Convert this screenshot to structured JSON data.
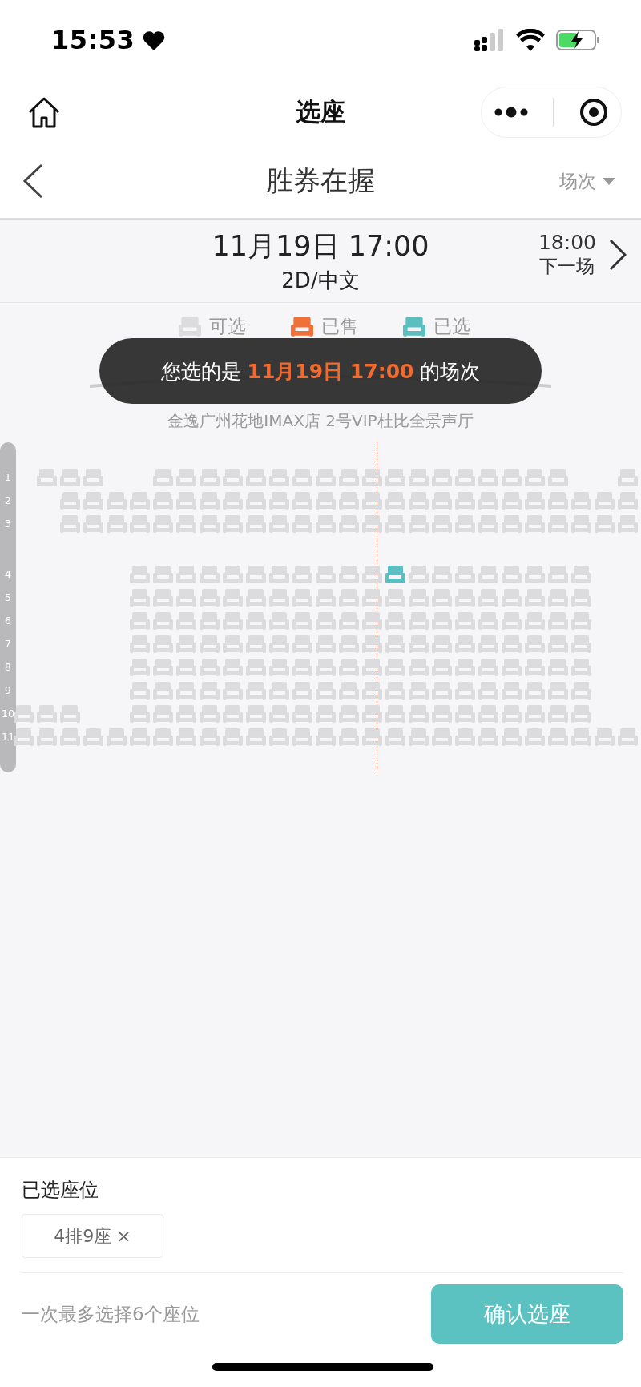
{
  "status_bar": {
    "time": "15:53"
  },
  "nav": {
    "title": "选座"
  },
  "movie": {
    "title": "胜券在握",
    "session_menu": "场次"
  },
  "session": {
    "date_time": "11月19日 17:00",
    "format": "2D/中文",
    "next_time": "18:00",
    "next_label": "下一场"
  },
  "legend": [
    {
      "kind": "available",
      "label": "可选"
    },
    {
      "kind": "sold",
      "label": "已售"
    },
    {
      "kind": "selected",
      "label": "已选"
    }
  ],
  "toast": {
    "text": "您选的是 **11月19日 17:00** 的场次"
  },
  "screen": {
    "label": "金逸广州花地IMAX店 2号VIP杜比全景声厅"
  },
  "rows": [
    {
      "label": "1",
      "cells": [
        {
          "kind": "empty"
        },
        {
          "kind": "seat",
          "selected": false
        },
        {
          "kind": "seat",
          "selected": false
        },
        {
          "kind": "seat",
          "selected": false
        },
        {
          "kind": "empty"
        },
        {
          "kind": "empty"
        },
        {
          "kind": "seat",
          "selected": false
        },
        {
          "kind": "seat",
          "selected": false
        },
        {
          "kind": "seat",
          "selected": false
        },
        {
          "kind": "seat",
          "selected": false
        },
        {
          "kind": "seat",
          "selected": false
        },
        {
          "kind": "seat",
          "selected": false
        },
        {
          "kind": "seat",
          "selected": false
        },
        {
          "kind": "seat",
          "selected": false
        },
        {
          "kind": "seat",
          "selected": false
        },
        {
          "kind": "seat",
          "selected": false
        },
        {
          "kind": "seat",
          "selected": false
        },
        {
          "kind": "seat",
          "selected": false
        },
        {
          "kind": "seat",
          "selected": false
        },
        {
          "kind": "seat",
          "selected": false
        },
        {
          "kind": "seat",
          "selected": false
        },
        {
          "kind": "seat",
          "selected": false
        },
        {
          "kind": "seat",
          "selected": false
        },
        {
          "kind": "seat",
          "selected": false
        },
        {
          "kind": "empty"
        },
        {
          "kind": "empty"
        },
        {
          "kind": "seat",
          "selected": false
        }
      ]
    },
    {
      "label": "2",
      "cells": [
        {
          "kind": "empty"
        },
        {
          "kind": "empty"
        },
        {
          "kind": "seat",
          "selected": false
        },
        {
          "kind": "seat",
          "selected": false
        },
        {
          "kind": "seat",
          "selected": false
        },
        {
          "kind": "seat",
          "selected": false
        },
        {
          "kind": "seat",
          "selected": false
        },
        {
          "kind": "seat",
          "selected": false
        },
        {
          "kind": "seat",
          "selected": false
        },
        {
          "kind": "seat",
          "selected": false
        },
        {
          "kind": "seat",
          "selected": false
        },
        {
          "kind": "seat",
          "selected": false
        },
        {
          "kind": "seat",
          "selected": false
        },
        {
          "kind": "seat",
          "selected": false
        },
        {
          "kind": "seat",
          "selected": false
        },
        {
          "kind": "seat",
          "selected": false
        },
        {
          "kind": "seat",
          "selected": false
        },
        {
          "kind": "seat",
          "selected": false
        },
        {
          "kind": "seat",
          "selected": false
        },
        {
          "kind": "seat",
          "selected": false
        },
        {
          "kind": "seat",
          "selected": false
        },
        {
          "kind": "seat",
          "selected": false
        },
        {
          "kind": "seat",
          "selected": false
        },
        {
          "kind": "seat",
          "selected": false
        },
        {
          "kind": "seat",
          "selected": false
        },
        {
          "kind": "seat",
          "selected": false
        },
        {
          "kind": "seat",
          "selected": false
        }
      ]
    },
    {
      "label": "3",
      "cells": [
        {
          "kind": "empty"
        },
        {
          "kind": "empty"
        },
        {
          "kind": "seat",
          "selected": false
        },
        {
          "kind": "seat",
          "selected": false
        },
        {
          "kind": "seat",
          "selected": false
        },
        {
          "kind": "seat",
          "selected": false
        },
        {
          "kind": "seat",
          "selected": false
        },
        {
          "kind": "seat",
          "selected": false
        },
        {
          "kind": "seat",
          "selected": false
        },
        {
          "kind": "seat",
          "selected": false
        },
        {
          "kind": "seat",
          "selected": false
        },
        {
          "kind": "seat",
          "selected": false
        },
        {
          "kind": "seat",
          "selected": false
        },
        {
          "kind": "seat",
          "selected": false
        },
        {
          "kind": "seat",
          "selected": false
        },
        {
          "kind": "seat",
          "selected": false
        },
        {
          "kind": "seat",
          "selected": false
        },
        {
          "kind": "seat",
          "selected": false
        },
        {
          "kind": "seat",
          "selected": false
        },
        {
          "kind": "seat",
          "selected": false
        },
        {
          "kind": "seat",
          "selected": false
        },
        {
          "kind": "seat",
          "selected": false
        },
        {
          "kind": "seat",
          "selected": false
        },
        {
          "kind": "seat",
          "selected": false
        },
        {
          "kind": "seat",
          "selected": false
        },
        {
          "kind": "seat",
          "selected": false
        },
        {
          "kind": "seat",
          "selected": false
        }
      ]
    },
    {
      "kind": "aisle"
    },
    {
      "label": "4",
      "cells": [
        {
          "kind": "empty"
        },
        {
          "kind": "empty"
        },
        {
          "kind": "empty"
        },
        {
          "kind": "empty"
        },
        {
          "kind": "empty"
        },
        {
          "kind": "seat",
          "selected": false
        },
        {
          "kind": "seat",
          "selected": false
        },
        {
          "kind": "seat",
          "selected": false
        },
        {
          "kind": "seat",
          "selected": false
        },
        {
          "kind": "seat",
          "selected": false
        },
        {
          "kind": "seat",
          "selected": false
        },
        {
          "kind": "seat",
          "selected": false
        },
        {
          "kind": "seat",
          "selected": false
        },
        {
          "kind": "seat",
          "selected": false
        },
        {
          "kind": "seat",
          "selected": false
        },
        {
          "kind": "seat",
          "selected": false
        },
        {
          "kind": "seat",
          "selected": true
        },
        {
          "kind": "seat",
          "selected": false
        },
        {
          "kind": "seat",
          "selected": false
        },
        {
          "kind": "seat",
          "selected": false
        },
        {
          "kind": "seat",
          "selected": false
        },
        {
          "kind": "seat",
          "selected": false
        },
        {
          "kind": "seat",
          "selected": false
        },
        {
          "kind": "seat",
          "selected": false
        },
        {
          "kind": "seat",
          "selected": false
        },
        {
          "kind": "empty"
        },
        {
          "kind": "empty"
        }
      ]
    },
    {
      "label": "5",
      "cells": [
        {
          "kind": "empty"
        },
        {
          "kind": "empty"
        },
        {
          "kind": "empty"
        },
        {
          "kind": "empty"
        },
        {
          "kind": "empty"
        },
        {
          "kind": "seat",
          "selected": false
        },
        {
          "kind": "seat",
          "selected": false
        },
        {
          "kind": "seat",
          "selected": false
        },
        {
          "kind": "seat",
          "selected": false
        },
        {
          "kind": "seat",
          "selected": false
        },
        {
          "kind": "seat",
          "selected": false
        },
        {
          "kind": "seat",
          "selected": false
        },
        {
          "kind": "seat",
          "selected": false
        },
        {
          "kind": "seat",
          "selected": false
        },
        {
          "kind": "seat",
          "selected": false
        },
        {
          "kind": "seat",
          "selected": false
        },
        {
          "kind": "seat",
          "selected": false
        },
        {
          "kind": "seat",
          "selected": false
        },
        {
          "kind": "seat",
          "selected": false
        },
        {
          "kind": "seat",
          "selected": false
        },
        {
          "kind": "seat",
          "selected": false
        },
        {
          "kind": "seat",
          "selected": false
        },
        {
          "kind": "seat",
          "selected": false
        },
        {
          "kind": "seat",
          "selected": false
        },
        {
          "kind": "seat",
          "selected": false
        },
        {
          "kind": "empty"
        },
        {
          "kind": "empty"
        }
      ]
    },
    {
      "label": "6",
      "cells": [
        {
          "kind": "empty"
        },
        {
          "kind": "empty"
        },
        {
          "kind": "empty"
        },
        {
          "kind": "empty"
        },
        {
          "kind": "empty"
        },
        {
          "kind": "seat",
          "selected": false
        },
        {
          "kind": "seat",
          "selected": false
        },
        {
          "kind": "seat",
          "selected": false
        },
        {
          "kind": "seat",
          "selected": false
        },
        {
          "kind": "seat",
          "selected": false
        },
        {
          "kind": "seat",
          "selected": false
        },
        {
          "kind": "seat",
          "selected": false
        },
        {
          "kind": "seat",
          "selected": false
        },
        {
          "kind": "seat",
          "selected": false
        },
        {
          "kind": "seat",
          "selected": false
        },
        {
          "kind": "seat",
          "selected": false
        },
        {
          "kind": "seat",
          "selected": false
        },
        {
          "kind": "seat",
          "selected": false
        },
        {
          "kind": "seat",
          "selected": false
        },
        {
          "kind": "seat",
          "selected": false
        },
        {
          "kind": "seat",
          "selected": false
        },
        {
          "kind": "seat",
          "selected": false
        },
        {
          "kind": "seat",
          "selected": false
        },
        {
          "kind": "seat",
          "selected": false
        },
        {
          "kind": "seat",
          "selected": false
        },
        {
          "kind": "empty"
        },
        {
          "kind": "empty"
        }
      ]
    },
    {
      "label": "7",
      "cells": [
        {
          "kind": "empty"
        },
        {
          "kind": "empty"
        },
        {
          "kind": "empty"
        },
        {
          "kind": "empty"
        },
        {
          "kind": "empty"
        },
        {
          "kind": "seat",
          "selected": false
        },
        {
          "kind": "seat",
          "selected": false
        },
        {
          "kind": "seat",
          "selected": false
        },
        {
          "kind": "seat",
          "selected": false
        },
        {
          "kind": "seat",
          "selected": false
        },
        {
          "kind": "seat",
          "selected": false
        },
        {
          "kind": "seat",
          "selected": false
        },
        {
          "kind": "seat",
          "selected": false
        },
        {
          "kind": "seat",
          "selected": false
        },
        {
          "kind": "seat",
          "selected": false
        },
        {
          "kind": "seat",
          "selected": false
        },
        {
          "kind": "seat",
          "selected": false
        },
        {
          "kind": "seat",
          "selected": false
        },
        {
          "kind": "seat",
          "selected": false
        },
        {
          "kind": "seat",
          "selected": false
        },
        {
          "kind": "seat",
          "selected": false
        },
        {
          "kind": "seat",
          "selected": false
        },
        {
          "kind": "seat",
          "selected": false
        },
        {
          "kind": "seat",
          "selected": false
        },
        {
          "kind": "seat",
          "selected": false
        },
        {
          "kind": "empty"
        },
        {
          "kind": "empty"
        }
      ]
    },
    {
      "label": "8",
      "cells": [
        {
          "kind": "empty"
        },
        {
          "kind": "empty"
        },
        {
          "kind": "empty"
        },
        {
          "kind": "empty"
        },
        {
          "kind": "empty"
        },
        {
          "kind": "seat",
          "selected": false
        },
        {
          "kind": "seat",
          "selected": false
        },
        {
          "kind": "seat",
          "selected": false
        },
        {
          "kind": "seat",
          "selected": false
        },
        {
          "kind": "seat",
          "selected": false
        },
        {
          "kind": "seat",
          "selected": false
        },
        {
          "kind": "seat",
          "selected": false
        },
        {
          "kind": "seat",
          "selected": false
        },
        {
          "kind": "seat",
          "selected": false
        },
        {
          "kind": "seat",
          "selected": false
        },
        {
          "kind": "seat",
          "selected": false
        },
        {
          "kind": "seat",
          "selected": false
        },
        {
          "kind": "seat",
          "selected": false
        },
        {
          "kind": "seat",
          "selected": false
        },
        {
          "kind": "seat",
          "selected": false
        },
        {
          "kind": "seat",
          "selected": false
        },
        {
          "kind": "seat",
          "selected": false
        },
        {
          "kind": "seat",
          "selected": false
        },
        {
          "kind": "seat",
          "selected": false
        },
        {
          "kind": "seat",
          "selected": false
        },
        {
          "kind": "empty"
        },
        {
          "kind": "empty"
        }
      ]
    },
    {
      "label": "9",
      "cells": [
        {
          "kind": "empty"
        },
        {
          "kind": "empty"
        },
        {
          "kind": "empty"
        },
        {
          "kind": "empty"
        },
        {
          "kind": "empty"
        },
        {
          "kind": "seat",
          "selected": false
        },
        {
          "kind": "seat",
          "selected": false
        },
        {
          "kind": "seat",
          "selected": false
        },
        {
          "kind": "seat",
          "selected": false
        },
        {
          "kind": "seat",
          "selected": false
        },
        {
          "kind": "seat",
          "selected": false
        },
        {
          "kind": "seat",
          "selected": false
        },
        {
          "kind": "seat",
          "selected": false
        },
        {
          "kind": "seat",
          "selected": false
        },
        {
          "kind": "seat",
          "selected": false
        },
        {
          "kind": "seat",
          "selected": false
        },
        {
          "kind": "seat",
          "selected": false
        },
        {
          "kind": "seat",
          "selected": false
        },
        {
          "kind": "seat",
          "selected": false
        },
        {
          "kind": "seat",
          "selected": false
        },
        {
          "kind": "seat",
          "selected": false
        },
        {
          "kind": "seat",
          "selected": false
        },
        {
          "kind": "seat",
          "selected": false
        },
        {
          "kind": "seat",
          "selected": false
        },
        {
          "kind": "seat",
          "selected": false
        },
        {
          "kind": "empty"
        },
        {
          "kind": "empty"
        }
      ]
    },
    {
      "label": "10",
      "cells": [
        {
          "kind": "seat",
          "selected": false
        },
        {
          "kind": "seat",
          "selected": false
        },
        {
          "kind": "seat",
          "selected": false
        },
        {
          "kind": "empty"
        },
        {
          "kind": "empty"
        },
        {
          "kind": "seat",
          "selected": false
        },
        {
          "kind": "seat",
          "selected": false
        },
        {
          "kind": "seat",
          "selected": false
        },
        {
          "kind": "seat",
          "selected": false
        },
        {
          "kind": "seat",
          "selected": false
        },
        {
          "kind": "seat",
          "selected": false
        },
        {
          "kind": "seat",
          "selected": false
        },
        {
          "kind": "seat",
          "selected": false
        },
        {
          "kind": "seat",
          "selected": false
        },
        {
          "kind": "seat",
          "selected": false
        },
        {
          "kind": "seat",
          "selected": false
        },
        {
          "kind": "seat",
          "selected": false
        },
        {
          "kind": "seat",
          "selected": false
        },
        {
          "kind": "seat",
          "selected": false
        },
        {
          "kind": "seat",
          "selected": false
        },
        {
          "kind": "seat",
          "selected": false
        },
        {
          "kind": "seat",
          "selected": false
        },
        {
          "kind": "seat",
          "selected": false
        },
        {
          "kind": "seat",
          "selected": false
        },
        {
          "kind": "seat",
          "selected": false
        },
        {
          "kind": "empty"
        },
        {
          "kind": "empty"
        }
      ]
    },
    {
      "label": "11",
      "cells": [
        {
          "kind": "seat",
          "selected": false
        },
        {
          "kind": "seat",
          "selected": false
        },
        {
          "kind": "seat",
          "selected": false
        },
        {
          "kind": "seat",
          "selected": false
        },
        {
          "kind": "seat",
          "selected": false
        },
        {
          "kind": "seat",
          "selected": false
        },
        {
          "kind": "seat",
          "selected": false
        },
        {
          "kind": "seat",
          "selected": false
        },
        {
          "kind": "seat",
          "selected": false
        },
        {
          "kind": "seat",
          "selected": false
        },
        {
          "kind": "seat",
          "selected": false
        },
        {
          "kind": "seat",
          "selected": false
        },
        {
          "kind": "seat",
          "selected": false
        },
        {
          "kind": "seat",
          "selected": false
        },
        {
          "kind": "seat",
          "selected": false
        },
        {
          "kind": "seat",
          "selected": false
        },
        {
          "kind": "seat",
          "selected": false
        },
        {
          "kind": "seat",
          "selected": false
        },
        {
          "kind": "seat",
          "selected": false
        },
        {
          "kind": "seat",
          "selected": false
        },
        {
          "kind": "seat",
          "selected": false
        },
        {
          "kind": "seat",
          "selected": false
        },
        {
          "kind": "seat",
          "selected": false
        },
        {
          "kind": "seat",
          "selected": false
        },
        {
          "kind": "seat",
          "selected": false
        },
        {
          "kind": "seat",
          "selected": false
        },
        {
          "kind": "seat",
          "selected": false
        }
      ]
    }
  ],
  "selection": {
    "title": "已选座位",
    "seats": [
      {
        "label": "4排9座",
        "remove": "×"
      }
    ]
  },
  "footer": {
    "hint": "一次最多选择6个座位",
    "confirm": "确认选座"
  }
}
